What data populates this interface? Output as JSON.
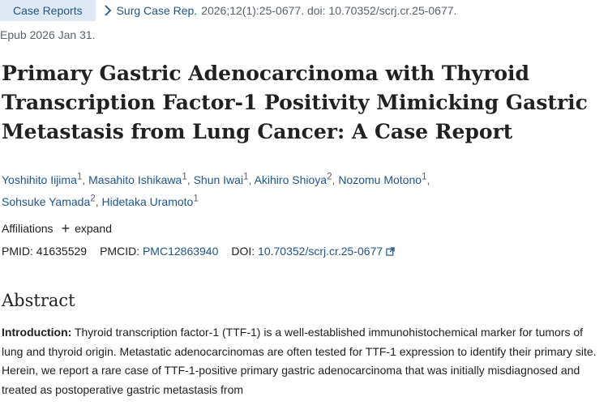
{
  "header": {
    "badge": "Case Reports",
    "journal": "Surg Case Rep.",
    "citation": "2026;12(1):25-0677. doi: 10.70352/scrj.cr.25-0677.",
    "epub": "Epub 2026 Jan 31."
  },
  "title": "Primary Gastric Adenocarcinoma with Thyroid Transcription Factor-1 Positivity Mimicking Gastric Metastasis from Lung Cancer: A Case Report",
  "authors": [
    {
      "name": "Yoshihito Iijima",
      "aff": "1"
    },
    {
      "name": "Masahito Ishikawa",
      "aff": "1"
    },
    {
      "name": "Shun Iwai",
      "aff": "1"
    },
    {
      "name": "Akihiro Shioya",
      "aff": "2"
    },
    {
      "name": "Nozomu Motono",
      "aff": "1"
    },
    {
      "name": "Sohsuke Yamada",
      "aff": "2"
    },
    {
      "name": "Hidetaka Uramoto",
      "aff": "1"
    }
  ],
  "affiliations": {
    "label": "Affiliations",
    "expand": "expand"
  },
  "ids": {
    "pmid_label": "PMID:",
    "pmid": "41635529",
    "pmcid_label": "PMCID:",
    "pmcid": "PMC12863940",
    "doi_label": "DOI:",
    "doi": "10.70352/scrj.cr.25-0677"
  },
  "abstract": {
    "heading": "Abstract",
    "intro_label": "Introduction:",
    "intro_text": "Thyroid transcription factor-1 (TTF-1) is a well-established immunohistochemical marker for tumors of lung and thyroid origin. Metastatic adenocarcinomas are often tested for TTF-1 expression to identify their primary site. Herein, we report a rare case of TTF-1-positive primary gastric adenocarcinoma that was initially misdiagnosed and treated as postoperative gastric metastasis from"
  },
  "icons": {
    "chevron": "chevron-right-icon",
    "plus": "plus-icon",
    "external": "external-link-icon"
  },
  "colors": {
    "link": "#20558a",
    "badge_bg": "#dfe9f6",
    "muted": "#5b616b"
  }
}
